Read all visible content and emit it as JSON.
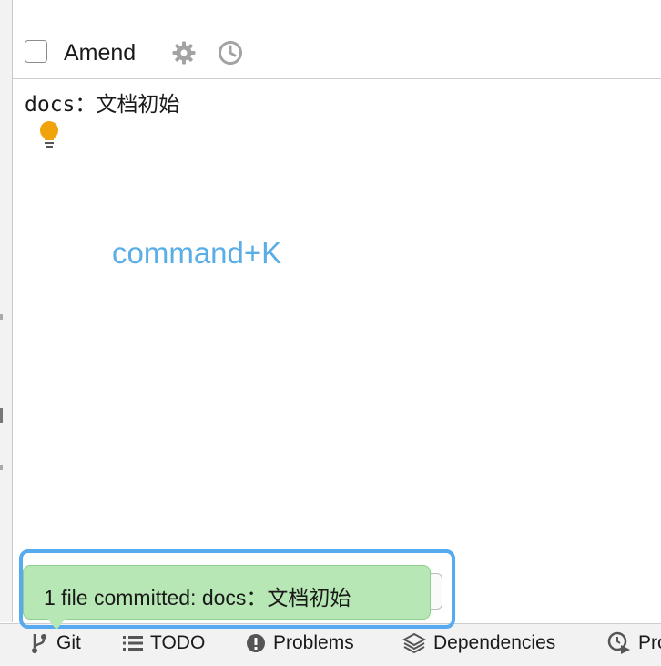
{
  "amend": {
    "label": "Amend",
    "checked": false
  },
  "commit_message": {
    "text": "docs：文档初始"
  },
  "hint": {
    "text": "command+K"
  },
  "notification": {
    "text": "1 file committed: docs：文档初始"
  },
  "toolbar": {
    "git": "Git",
    "todo": "TODO",
    "problems": "Problems",
    "dependencies": "Dependencies",
    "profiler": "Pro"
  },
  "colors": {
    "hint": "#5aaee8",
    "notification_bg": "#b6e7b4",
    "highlight_frame": "#56aaf0",
    "bulb": "#f0a30a"
  },
  "icons": [
    "gear-icon",
    "clock-icon",
    "lightbulb-icon",
    "git-branch-icon",
    "list-icon",
    "exclamation-icon",
    "layers-icon",
    "profiler-icon"
  ]
}
